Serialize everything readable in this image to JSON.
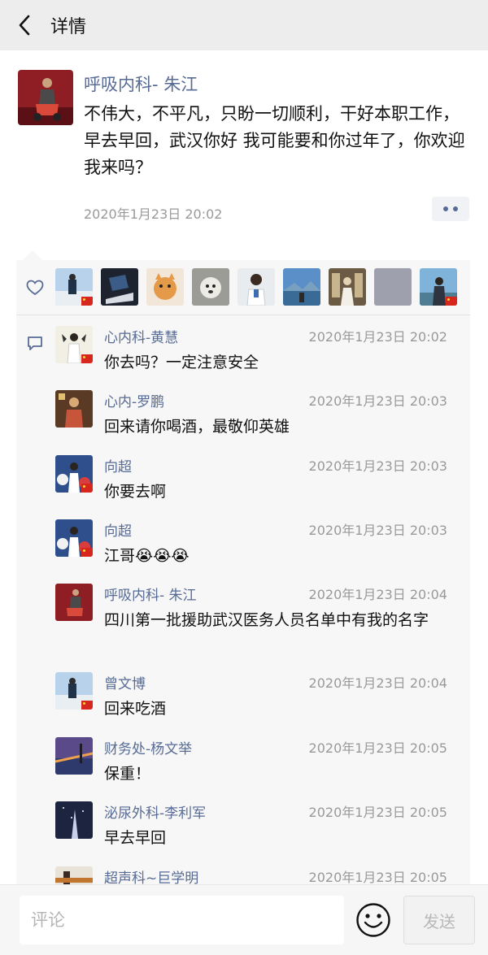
{
  "header": {
    "title": "详情"
  },
  "post": {
    "author": "呼吸内科- 朱江",
    "text": "不伟大，不平凡，只盼一切顺利，干好本职工作，早去早回，武汉你好 我可能要和你过年了，你欢迎我来吗？",
    "time": "2020年1月23日 20:02"
  },
  "comments": [
    {
      "name": "心内科-黄慧",
      "time": "2020年1月23日 20:02",
      "text": "你去吗？一定注意安全"
    },
    {
      "name": "心内-罗鹏",
      "time": "2020年1月23日 20:03",
      "text": "回来请你喝酒，最敬仰英雄"
    },
    {
      "name": "向超",
      "time": "2020年1月23日 20:03",
      "text": "你要去啊"
    },
    {
      "name": "向超",
      "time": "2020年1月23日 20:03",
      "text": "江哥😭😭😭"
    },
    {
      "name": "呼吸内科- 朱江",
      "time": "2020年1月23日 20:04",
      "text": "四川第一批援助武汉医务人员名单中有我的名字"
    },
    {
      "name": "曾文博",
      "time": "2020年1月23日 20:04",
      "text": "回来吃酒"
    },
    {
      "name": "财务处-杨文举",
      "time": "2020年1月23日 20:05",
      "text": "保重！"
    },
    {
      "name": "泌尿外科-李利军",
      "time": "2020年1月23日 20:05",
      "text": "早去早回"
    },
    {
      "name": "超声科~巨学明",
      "time": "2020年1月23日 20:05",
      "text": ""
    }
  ],
  "footer": {
    "placeholder": "评论",
    "send_label": "发送"
  },
  "colors": {
    "name_link": "#576b95",
    "header_bg": "#ededed",
    "panel_bg": "#f7f7f7",
    "time": "#999999"
  },
  "icons": {
    "back": "chevron-left-icon",
    "like": "heart-icon",
    "comment": "comment-icon",
    "emoji": "smiley-icon"
  }
}
